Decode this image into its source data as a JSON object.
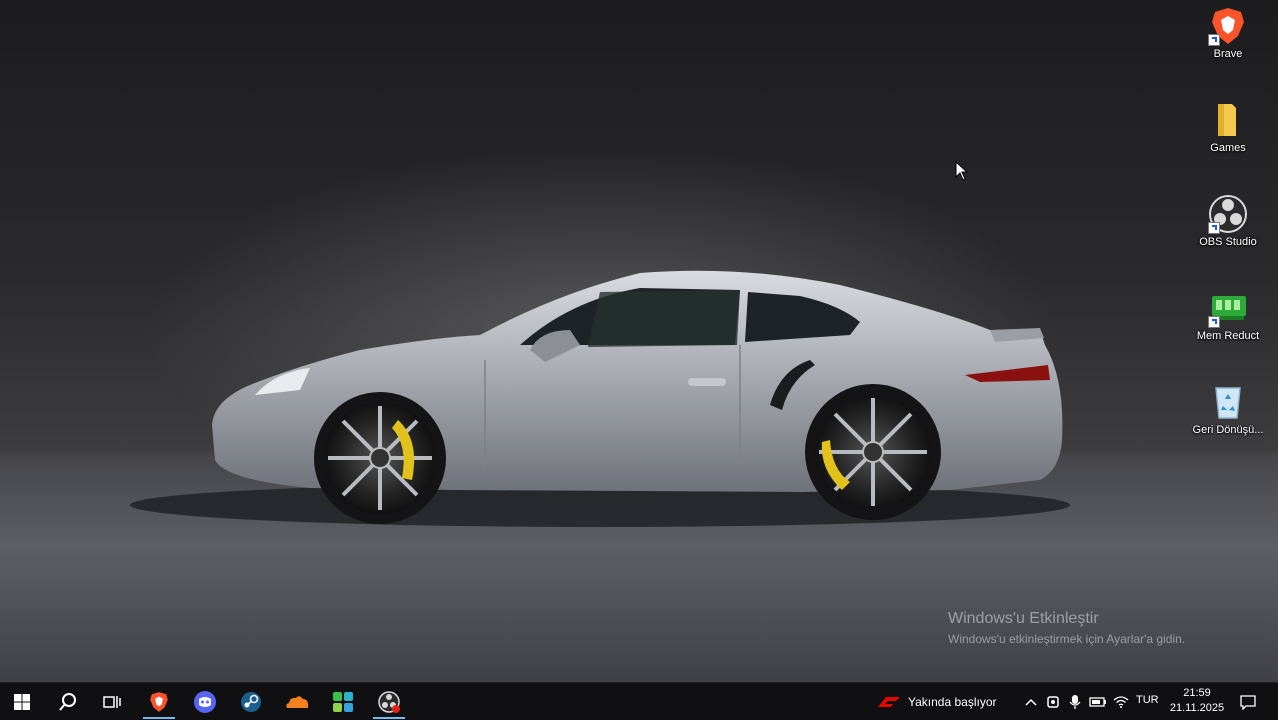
{
  "desktop": {
    "icons": [
      {
        "label": "Brave",
        "icon": "brave-lion-icon"
      },
      {
        "label": "Games",
        "icon": "folder-icon"
      },
      {
        "label": "OBS Studio",
        "icon": "obs-icon"
      },
      {
        "label": "Mem Reduct",
        "icon": "mem-reduct-icon"
      },
      {
        "label": "Geri Dönüşü...",
        "icon": "recycle-bin-icon"
      }
    ],
    "activation": {
      "title": "Windows'u Etkinleştir",
      "subtitle": "Windows'u etkinleştirmek için Ayarlar'a gidin."
    }
  },
  "taskbar": {
    "pinned": [
      "start-icon",
      "search-icon",
      "task-view-icon",
      "brave-icon",
      "discord-icon",
      "steam-icon",
      "cloudflare-icon",
      "app-grid-icon",
      "obs-icon"
    ],
    "news": {
      "text": "Yakında başlıyor",
      "icon": "f1-logo-icon"
    },
    "language": "TUR",
    "clock": {
      "time": "21:59",
      "date": "21.11.2025"
    }
  },
  "colors": {
    "accent": "#76b9ed",
    "taskbar": "#101012",
    "brave": "#fb542b",
    "folder": "#f4c94c",
    "discord": "#5865f2"
  }
}
